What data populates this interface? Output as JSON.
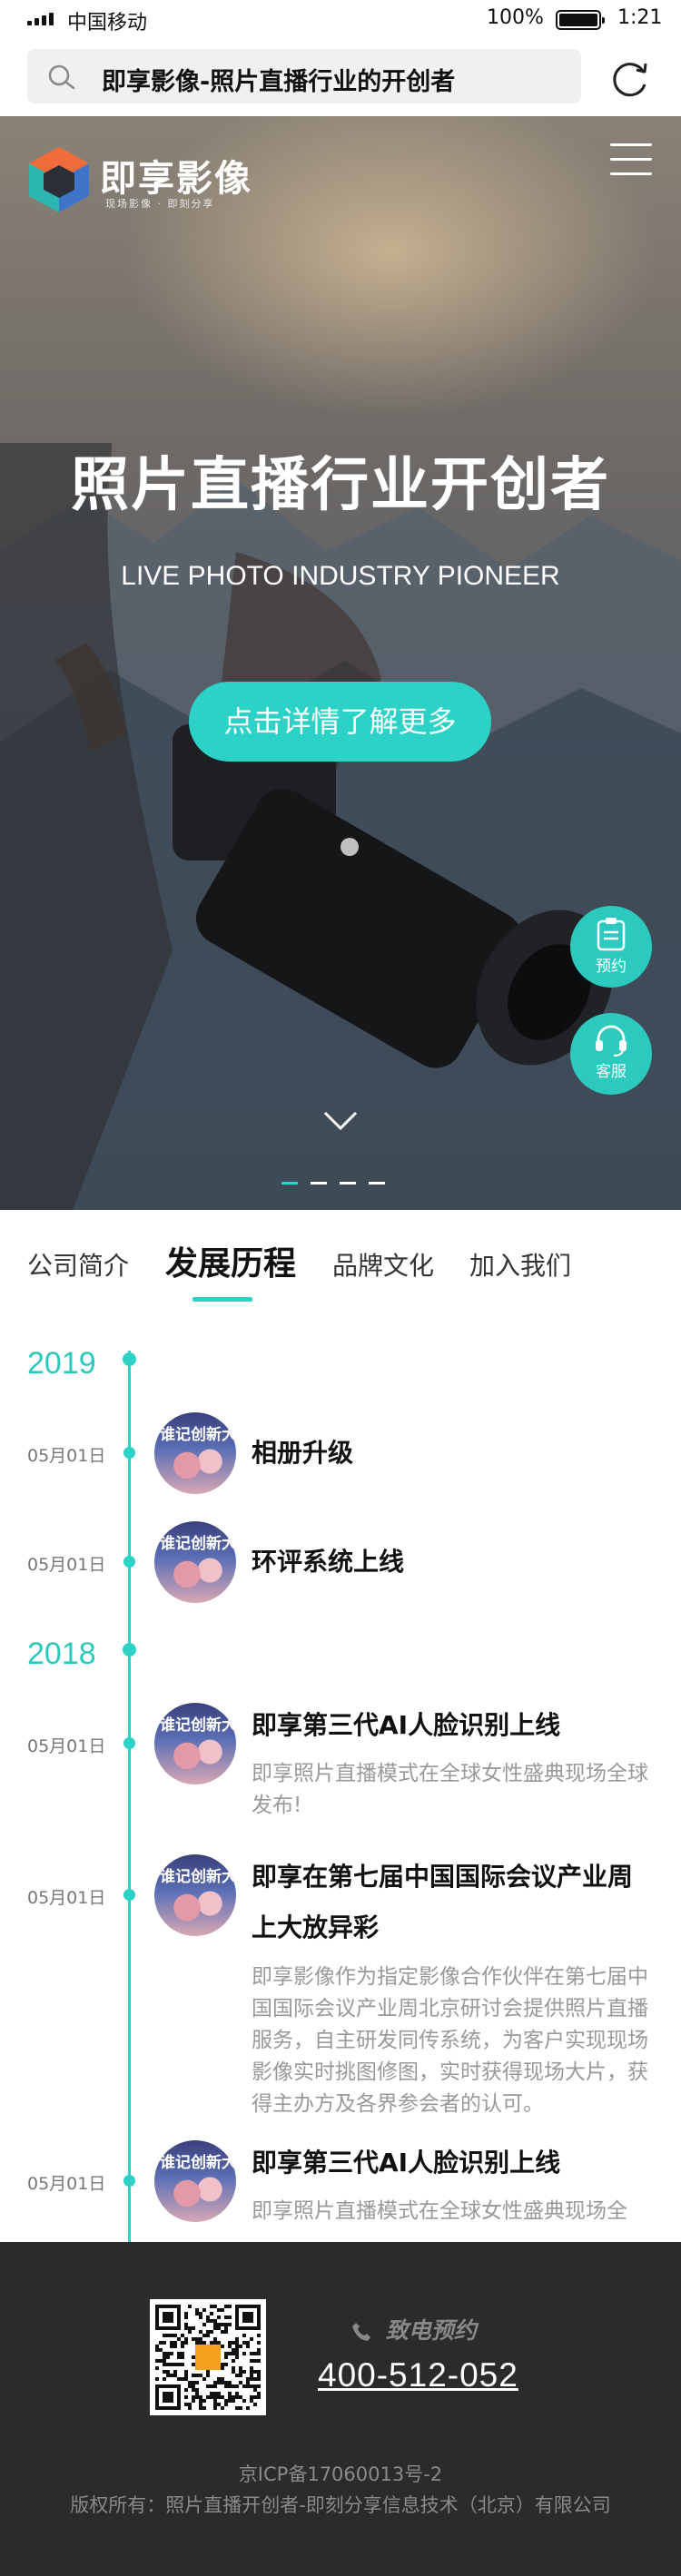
{
  "statusbar": {
    "carrier": "中国移动",
    "battery": "100%",
    "time": "1:21"
  },
  "addressbar": {
    "title": "即享影像-照片直播行业的开创者"
  },
  "hero": {
    "brand": "即享影像",
    "slogan": "现场影像 · 即刻分享",
    "headline": "照片直播行业开创者",
    "subheadline": "LIVE PHOTO INDUSTRY PIONEER",
    "cta": "点击详情了解更多",
    "float_booking": "预约",
    "float_service": "客服",
    "slides_total": 4,
    "slide_active": 1
  },
  "tabs": [
    "公司简介",
    "发展历程",
    "品牌文化",
    "加入我们"
  ],
  "active_tab": "发展历程",
  "timeline": {
    "avatar_text": "谁记创新大",
    "years": [
      {
        "year": "2019",
        "items": [
          {
            "date": "05月01日",
            "title": "相册升级",
            "desc": ""
          },
          {
            "date": "05月01日",
            "title": "环评系统上线",
            "desc": ""
          }
        ]
      },
      {
        "year": "2018",
        "items": [
          {
            "date": "05月01日",
            "title": "即享第三代AI人脸识别上线",
            "desc": "即享照片直播模式在全球女性盛典现场全球发布!"
          },
          {
            "date": "05月01日",
            "title": "即享在第七届中国国际会议产业周上大放异彩",
            "desc": "即享影像作为指定影像合作伙伴在第七届中国国际会议产业周北京研讨会提供照片直播服务，自主研发同传系统，为客户实现现场影像实时挑图修图，实时获得现场大片，获得主办方及各界参会者的认可。"
          },
          {
            "date": "05月01日",
            "title": "即享第三代AI人脸识别上线",
            "desc": "即享照片直播模式在全球女性盛典现场全"
          }
        ]
      }
    ]
  },
  "footer": {
    "call_label": "致电预约",
    "phone": "400-512-052",
    "icp": "京ICP备17060013号-2",
    "copyright": "版权所有：照片直播开创者-即刻分享信息技术（北京）有限公司"
  },
  "colors": {
    "accent": "#2cd2c6",
    "footer_bg": "#2b2b2b"
  }
}
